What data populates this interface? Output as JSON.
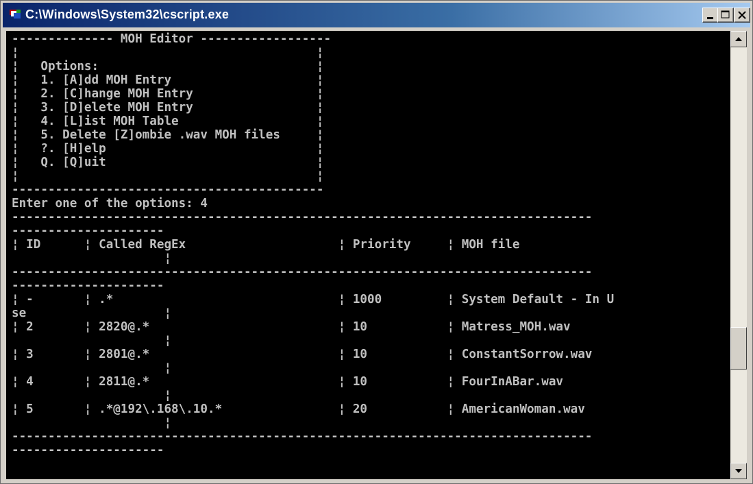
{
  "window": {
    "title": "C:\\Windows\\System32\\cscript.exe",
    "controls": [
      "minimize-icon",
      "maximize-icon",
      "close-icon"
    ]
  },
  "console": {
    "lines": [
      "-------------- MOH Editor ------------------",
      "¦                                         ¦",
      "¦   Options:                              ¦",
      "¦   1. [A]dd MOH Entry                    ¦",
      "¦   2. [C]hange MOH Entry                 ¦",
      "¦   3. [D]elete MOH Entry                 ¦",
      "¦   4. [L]ist MOH Table                   ¦",
      "¦   5. Delete [Z]ombie .wav MOH files     ¦",
      "¦   ?. [H]elp                             ¦",
      "¦   Q. [Q]uit                             ¦",
      "¦                                         ¦",
      "-------------------------------------------",
      "Enter one of the options: 4",
      "--------------------------------------------------------------------------------",
      "---------------------",
      "¦ ID      ¦ Called RegEx                     ¦ Priority     ¦ MOH file",
      "                     ¦",
      "--------------------------------------------------------------------------------",
      "---------------------",
      "¦ -       ¦ .*                               ¦ 1000         ¦ System Default - In U",
      "se                   ¦",
      "¦ 2       ¦ 2820@.*                          ¦ 10           ¦ Matress_MOH.wav",
      "                     ¦",
      "¦ 3       ¦ 2801@.*                          ¦ 10           ¦ ConstantSorrow.wav",
      "                     ¦",
      "¦ 4       ¦ 2811@.*                          ¦ 10           ¦ FourInABar.wav",
      "                     ¦",
      "¦ 5       ¦ .*@192\\.168\\.10.*                ¦ 20           ¦ AmericanWoman.wav",
      "                     ¦",
      "--------------------------------------------------------------------------------",
      "---------------------",
      ""
    ]
  },
  "scrollbar": {
    "up_icon": "arrow-up-icon",
    "down_icon": "arrow-down-icon",
    "position_fraction": 0.72
  }
}
